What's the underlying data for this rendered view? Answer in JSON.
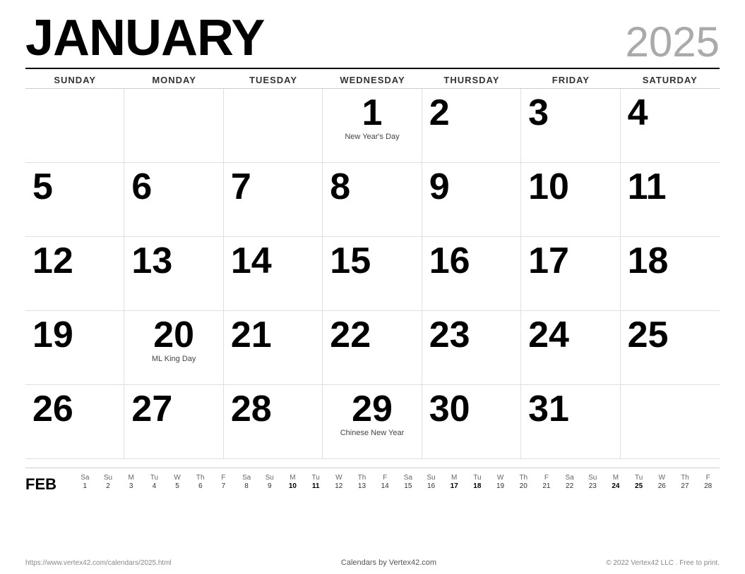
{
  "header": {
    "month": "JANUARY",
    "year": "2025"
  },
  "day_names": [
    "SUNDAY",
    "MONDAY",
    "TUESDAY",
    "WEDNESDAY",
    "THURSDAY",
    "FRIDAY",
    "SATURDAY"
  ],
  "weeks": [
    [
      {
        "day": "",
        "holiday": ""
      },
      {
        "day": "",
        "holiday": ""
      },
      {
        "day": "",
        "holiday": ""
      },
      {
        "day": "1",
        "holiday": "New Year's Day"
      },
      {
        "day": "2",
        "holiday": ""
      },
      {
        "day": "3",
        "holiday": ""
      },
      {
        "day": "4",
        "holiday": ""
      }
    ],
    [
      {
        "day": "5",
        "holiday": ""
      },
      {
        "day": "6",
        "holiday": ""
      },
      {
        "day": "7",
        "holiday": ""
      },
      {
        "day": "8",
        "holiday": ""
      },
      {
        "day": "9",
        "holiday": ""
      },
      {
        "day": "10",
        "holiday": ""
      },
      {
        "day": "11",
        "holiday": ""
      }
    ],
    [
      {
        "day": "12",
        "holiday": ""
      },
      {
        "day": "13",
        "holiday": ""
      },
      {
        "day": "14",
        "holiday": ""
      },
      {
        "day": "15",
        "holiday": ""
      },
      {
        "day": "16",
        "holiday": ""
      },
      {
        "day": "17",
        "holiday": ""
      },
      {
        "day": "18",
        "holiday": ""
      }
    ],
    [
      {
        "day": "19",
        "holiday": ""
      },
      {
        "day": "20",
        "holiday": "ML King Day"
      },
      {
        "day": "21",
        "holiday": ""
      },
      {
        "day": "22",
        "holiday": ""
      },
      {
        "day": "23",
        "holiday": ""
      },
      {
        "day": "24",
        "holiday": ""
      },
      {
        "day": "25",
        "holiday": ""
      }
    ],
    [
      {
        "day": "26",
        "holiday": ""
      },
      {
        "day": "27",
        "holiday": ""
      },
      {
        "day": "28",
        "holiday": ""
      },
      {
        "day": "29",
        "holiday": "Chinese New Year"
      },
      {
        "day": "30",
        "holiday": ""
      },
      {
        "day": "31",
        "holiday": ""
      },
      {
        "day": "",
        "holiday": ""
      }
    ]
  ],
  "mini": {
    "label": "FEB",
    "headers": [
      "Sa",
      "Su",
      "M",
      "Tu",
      "W",
      "Th",
      "F",
      "Sa",
      "Su",
      "M",
      "Tu",
      "W",
      "Th",
      "F",
      "Sa",
      "Su",
      "M",
      "Tu",
      "W",
      "Th",
      "F",
      "Sa",
      "Su",
      "M",
      "Tu",
      "W",
      "Th",
      "F"
    ],
    "days": [
      "1",
      "2",
      "3",
      "4",
      "5",
      "6",
      "7",
      "8",
      "9",
      "10",
      "11",
      "12",
      "13",
      "14",
      "15",
      "16",
      "17",
      "18",
      "19",
      "20",
      "21",
      "22",
      "23",
      "24",
      "25",
      "26",
      "27",
      "28"
    ],
    "bold_days": [
      "10",
      "11",
      "17",
      "18",
      "24",
      "25"
    ]
  },
  "footer": {
    "left": "https://www.vertex42.com/calendars/2025.html",
    "center": "Calendars by Vertex42.com",
    "right": "© 2022 Vertex42 LLC . Free to print."
  }
}
